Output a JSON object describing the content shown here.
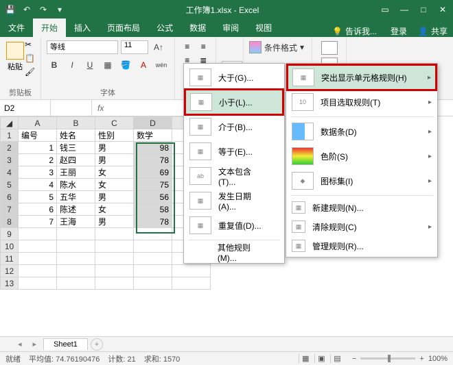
{
  "app": {
    "title": "工作簿1.xlsx - Excel"
  },
  "tabs": {
    "file": "文件",
    "home": "开始",
    "insert": "插入",
    "layout": "页面布局",
    "formulas": "公式",
    "data": "数据",
    "review": "审阅",
    "view": "视图",
    "tell": "告诉我...",
    "signin": "登录",
    "share": "共享"
  },
  "ribbon": {
    "paste": "粘贴",
    "clipboard": "剪贴板",
    "font_group": "字体",
    "font_name": "等线",
    "font_size": "11",
    "bold": "B",
    "italic": "I",
    "underline": "U",
    "cond_format": "条件格式",
    "percent": "%"
  },
  "namebox": "D2",
  "fx": "fx",
  "cols": [
    "A",
    "B",
    "C",
    "D"
  ],
  "header": {
    "A": "编号",
    "B": "姓名",
    "C": "性别",
    "D": "数学"
  },
  "rows": [
    {
      "n": "1",
      "A": "1",
      "B": "钱三",
      "C": "男",
      "D": "98"
    },
    {
      "n": "2",
      "A": "2",
      "B": "赵四",
      "C": "男",
      "D": "78"
    },
    {
      "n": "3",
      "A": "3",
      "B": "王丽",
      "C": "女",
      "D": "69"
    },
    {
      "n": "4",
      "A": "4",
      "B": "陈水",
      "C": "女",
      "D": "75"
    },
    {
      "n": "5",
      "A": "5",
      "B": "五华",
      "C": "男",
      "D": "56"
    },
    {
      "n": "6",
      "A": "6",
      "B": "陈述",
      "C": "女",
      "D": "58"
    },
    {
      "n": "7",
      "A": "7",
      "B": "王海",
      "C": "男",
      "D": "78"
    }
  ],
  "menu1": {
    "gt": "大于(G)...",
    "lt": "小于(L)...",
    "between": "介于(B)...",
    "eq": "等于(E)...",
    "text": "文本包含(T)...",
    "date": "发生日期(A)...",
    "dup": "重复值(D)...",
    "other": "其他规则(M)..."
  },
  "menu2": {
    "highlight": "突出显示单元格规则(H)",
    "top": "项目选取规则(T)",
    "databar": "数据条(D)",
    "colorscale": "色阶(S)",
    "iconset": "图标集(I)",
    "new": "新建规则(N)...",
    "clear": "清除规则(C)",
    "manage": "管理规则(R)..."
  },
  "sheet": {
    "name": "Sheet1"
  },
  "status": {
    "ready": "就绪",
    "avg": "平均值: 74.76190476",
    "count": "计数: 21",
    "sum": "求和: 1570",
    "zoom": "100%"
  }
}
